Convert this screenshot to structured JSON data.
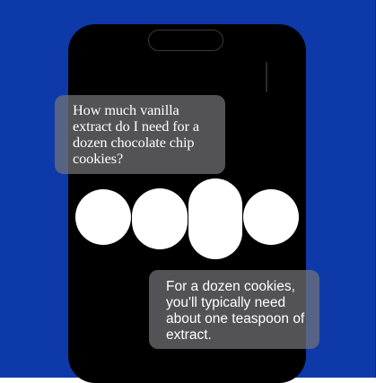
{
  "colors": {
    "background": "#0d3aa8",
    "phone_screen": "#000000",
    "bubble": "#737376",
    "text": "#ffffff"
  },
  "conversation": {
    "user_message": "How much vanilla extract do I need for a dozen chocolate chip cookies?",
    "assistant_message": "For a dozen cookies, you'll typically need about one teaspoon of extract."
  },
  "voice_indicator": {
    "icon": "voice-activity-dots",
    "dot_count": 4
  }
}
